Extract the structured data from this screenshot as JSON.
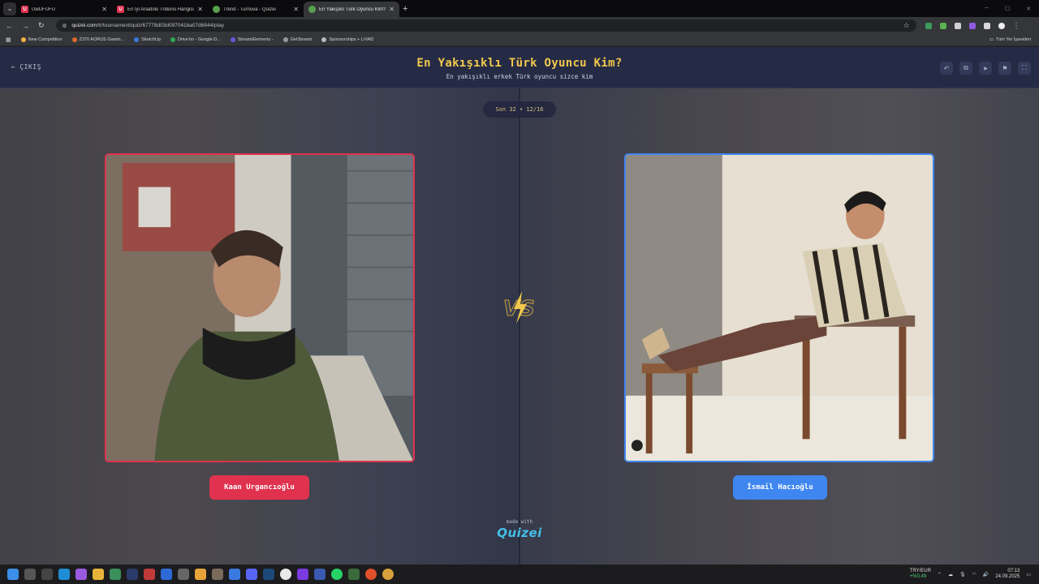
{
  "browser": {
    "tabs": [
      {
        "title": "UwUFUFU",
        "favicon_color": "#e0324f",
        "favicon_letter": "U",
        "active": false
      },
      {
        "title": "En İyi Anadolu Tribünü Hangisi",
        "favicon_color": "#e0324f",
        "favicon_letter": "U",
        "active": false
      },
      {
        "title": "Trend - Turnuva - Quizei",
        "favicon_color": "#5aa04e",
        "favicon_letter": "",
        "active": false
      },
      {
        "title": "En Yakışıklı Türk Oyuncu Kim?",
        "favicon_color": "#5aa04e",
        "favicon_letter": "",
        "active": true
      }
    ],
    "new_tab": "+",
    "url_host": "quizei.com",
    "url_path": "/tr/tournament/quiz/67778d03d097041ba07d6844/play",
    "bookmarks": [
      {
        "label": "New Competition",
        "color": "#f5b342"
      },
      {
        "label": "Z370 AORUS Gamin...",
        "color": "#e36b2b"
      },
      {
        "label": "SketchUp",
        "color": "#3c7ae0"
      },
      {
        "label": "Drive'ım - Google D...",
        "color": "#34a853"
      },
      {
        "label": "StreamElements -",
        "color": "#6b57e0"
      },
      {
        "label": "GetStream",
        "color": "#999999"
      },
      {
        "label": "Sponsorships + LIVAD",
        "color": "#bbbbbb"
      }
    ],
    "bookmarks_folder": "Tüm Yer İşaretleri"
  },
  "header": {
    "exit_label": "ÇIKIŞ",
    "title": "En Yakışıklı Türk Oyuncu Kim?",
    "subtitle": "En yakışıklı erkek Türk oyuncu sizce kim"
  },
  "round": {
    "label": "Son 32 • 12/16"
  },
  "contestants": {
    "left": {
      "name": "Kaan Urgancıoğlu",
      "accent": "#e0324f"
    },
    "right": {
      "name": "İsmail Hacıoğlu",
      "accent": "#3f86f0"
    }
  },
  "footer": {
    "made_with": "made with",
    "brand": "Quizei"
  },
  "taskbar": {
    "currency_pair": "TRY/EUR",
    "currency_change": "+%0,49",
    "time": "07:13",
    "date": "24.09.2025"
  },
  "colors": {
    "title": "#f2c94c",
    "left": "#e0324f",
    "right": "#3f86f0",
    "header_bg": "#262b45"
  }
}
